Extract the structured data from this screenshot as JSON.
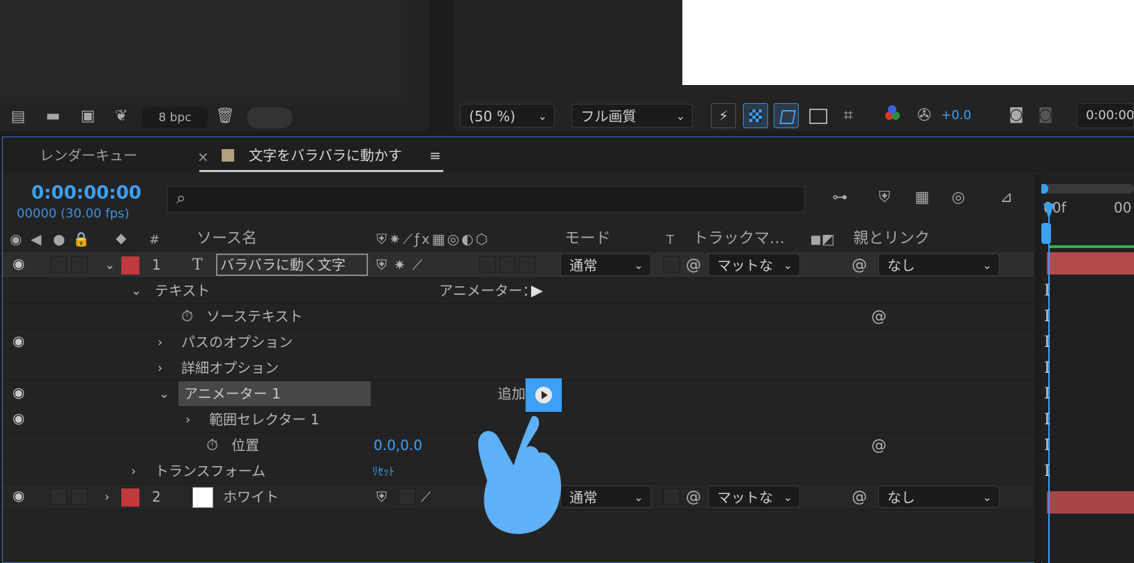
{
  "project_toolbar": {
    "bpc": "8 bpc"
  },
  "viewer_toolbar": {
    "zoom": "(50 %)",
    "quality": "フル画質",
    "exposure": "+0.0",
    "timecode": "0:00:00"
  },
  "tabs": {
    "render_queue": "レンダーキュー",
    "comp_close": "×",
    "comp_name": "文字をバラバラに動かす",
    "menu": "≡"
  },
  "timeline": {
    "current_time": "0:00:00:00",
    "frames": "00000 (30.00 fps)",
    "ruler_label": "00f",
    "ruler_label2": "00",
    "search_icon": "⌕"
  },
  "columns": {
    "number": "#",
    "source_name": "ソース名",
    "mode": "モード",
    "t": "T",
    "track_matte": "トラックマ…",
    "parent_link": "親とリンク"
  },
  "layers": [
    {
      "number": "1",
      "name": "バラバラに動く文字",
      "mode": "通常",
      "matte": "マットな",
      "parent": "なし",
      "color": "#c0393b"
    },
    {
      "number": "2",
      "name": "ホワイト",
      "mode": "通常",
      "matte": "マットな",
      "parent": "なし",
      "color": "#c0393b"
    }
  ],
  "props": {
    "text": "テキスト",
    "animator_label": "アニメーター：",
    "source_text": "ソーステキスト",
    "path_options": "パスのオプション",
    "more_options": "詳細オプション",
    "animator1": "アニメーター 1",
    "add": "追加",
    "range_selector": "範囲セレクター 1",
    "position": "位置",
    "position_value": "0.0,0.0",
    "transform": "トランスフォーム",
    "reset": "ﾘｾｯﾄ"
  },
  "colors": {
    "accent": "#3d9ff5",
    "hand": "#5eb1f7",
    "label_red": "#c0393b"
  }
}
